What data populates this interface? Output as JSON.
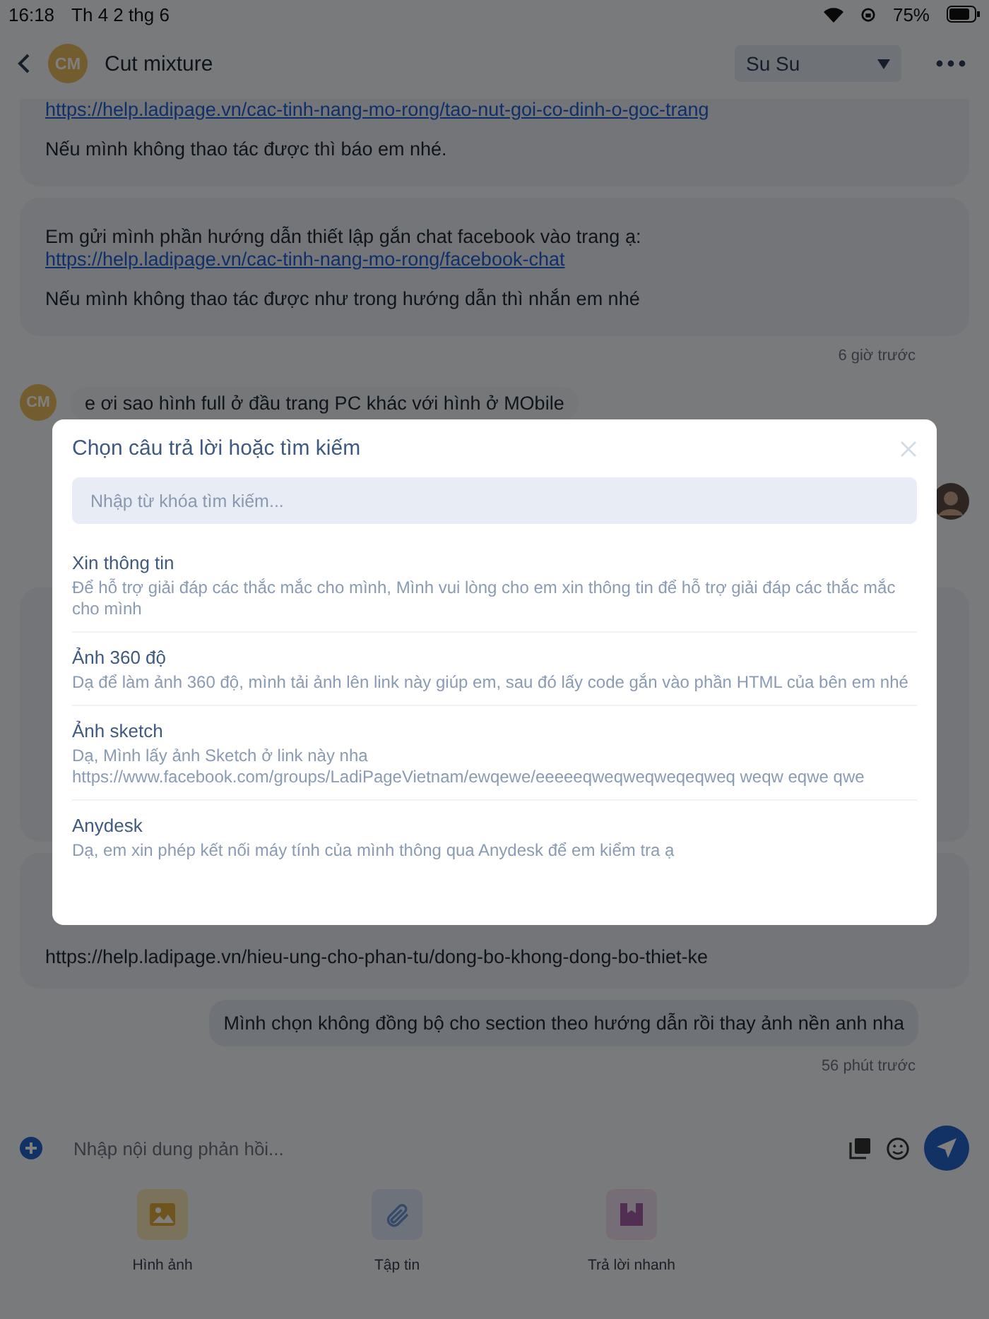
{
  "status_bar": {
    "time": "16:18",
    "date": "Th 4 2 thg 6",
    "battery": "75%"
  },
  "header": {
    "avatar_initials": "CM",
    "title": "Cut mixture",
    "assignee": "Su Su"
  },
  "messages": [
    {
      "kind": "card",
      "cut_top": true,
      "lines": [
        {
          "text": "https://help.ladipage.vn/cac-tinh-nang-mo-rong/tao-nut-goi-co-dinh-o-goc-trang",
          "link": true,
          "spaced": false
        },
        {
          "text": "Nếu mình không thao tác được thì báo em nhé.",
          "link": false,
          "spaced": true
        }
      ]
    },
    {
      "kind": "card",
      "cut_top": false,
      "lines": [
        {
          "text": "Em gửi mình phần hướng dẫn thiết lập gắn chat facebook vào trang ạ:",
          "link": false,
          "spaced": false
        },
        {
          "text": "https://help.ladipage.vn/cac-tinh-nang-mo-rong/facebook-chat",
          "link": true,
          "spaced": false
        },
        {
          "text": "Nếu mình không thao tác được như trong hướng dẫn thì nhắn em nhé",
          "link": false,
          "spaced": true
        }
      ]
    },
    {
      "kind": "time",
      "text": "6 giờ trước"
    },
    {
      "kind": "incoming",
      "avatar_initials": "CM",
      "text": "e ơi sao hình full ở đầu trang PC khác với hình ở MObile"
    },
    {
      "kind": "agent_avatar"
    },
    {
      "kind": "covered_card"
    },
    {
      "kind": "card",
      "cut_top": false,
      "covered_top": true,
      "lines": [
        {
          "text": "https://help.ladipage.vn/hieu-ung-cho-phan-tu/dong-bo-khong-dong-bo-thiet-ke",
          "link": false,
          "spaced": false
        }
      ]
    },
    {
      "kind": "outgoing",
      "text": "Mình chọn không đồng bộ cho section theo hướng dẫn rồi thay ảnh nền anh nha"
    },
    {
      "kind": "time",
      "text": "56 phút trước"
    }
  ],
  "composer": {
    "placeholder": "Nhập nội dung phản hồi..."
  },
  "actions": [
    {
      "kind": "image",
      "label": "Hình ảnh"
    },
    {
      "kind": "file",
      "label": "Tập tin"
    },
    {
      "kind": "quick",
      "label": "Trả lời nhanh"
    }
  ],
  "modal": {
    "title": "Chọn câu trả lời hoặc tìm kiếm",
    "search_placeholder": "Nhập từ khóa tìm kiếm...",
    "replies": [
      {
        "title": "Xin thông tin",
        "text": "Để hỗ trợ giải đáp các thắc mắc cho mình,  Mình vui lòng cho em xin thông tin để hỗ trợ giải đáp các thắc mắc cho mình"
      },
      {
        "title": "Ảnh 360 độ",
        "text": "Dạ để làm ảnh 360 độ, mình tải ảnh lên link này giúp em, sau đó lấy code gắn vào phần HTML của bên em nhé"
      },
      {
        "title": "Ảnh sketch",
        "text": "Dạ, Mình lấy ảnh Sketch ở link này nha https://www.facebook.com/groups/LadiPageVietnam/ewqewe/eeeeeqweqweqweqeqweq weqw eqwe qwe"
      },
      {
        "title": "Anydesk",
        "text": "Dạ, em xin phép kết nối máy tính của mình thông qua Anydesk để em kiểm tra ạ"
      }
    ]
  }
}
